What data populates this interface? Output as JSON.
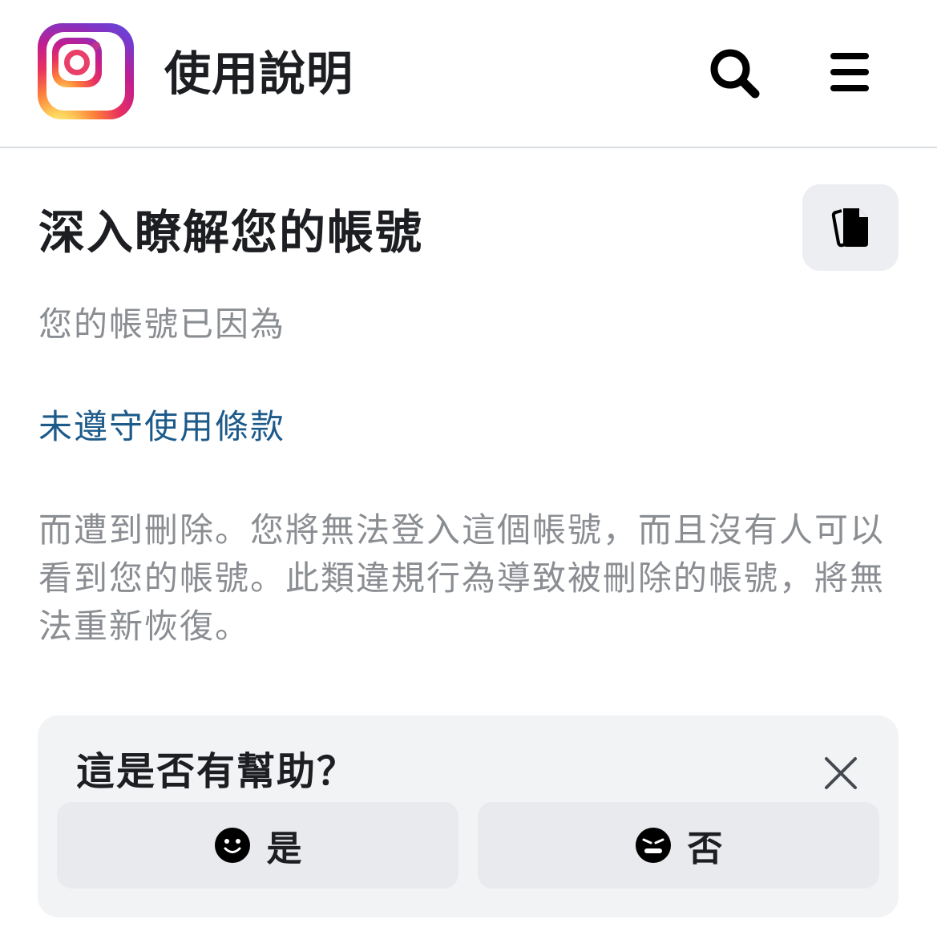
{
  "header": {
    "logo_icon": "instagram-logo",
    "title": "使用說明",
    "search_icon": "search-icon",
    "menu_icon": "hamburger-menu-icon"
  },
  "article": {
    "title": "深入瞭解您的帳號",
    "copy_icon": "copy-icon",
    "paragraph_1": "您的帳號已因為",
    "link_text": "未遵守使用條款",
    "paragraph_2": "而遭到刪除。您將無法登入這個帳號，而且沒有人可以看到您的帳號。此類違規行為導致被刪除的帳號，將無法重新恢復。"
  },
  "feedback": {
    "question": "這是否有幫助？",
    "close_icon": "close-icon",
    "yes_label": "是",
    "yes_icon": "smile-icon",
    "no_label": "否",
    "no_icon": "frown-icon"
  },
  "colors": {
    "link": "#1c5a8a",
    "muted_text": "#8a8d91",
    "button_bg": "#e8eaed",
    "panel_bg": "#f2f3f5"
  }
}
